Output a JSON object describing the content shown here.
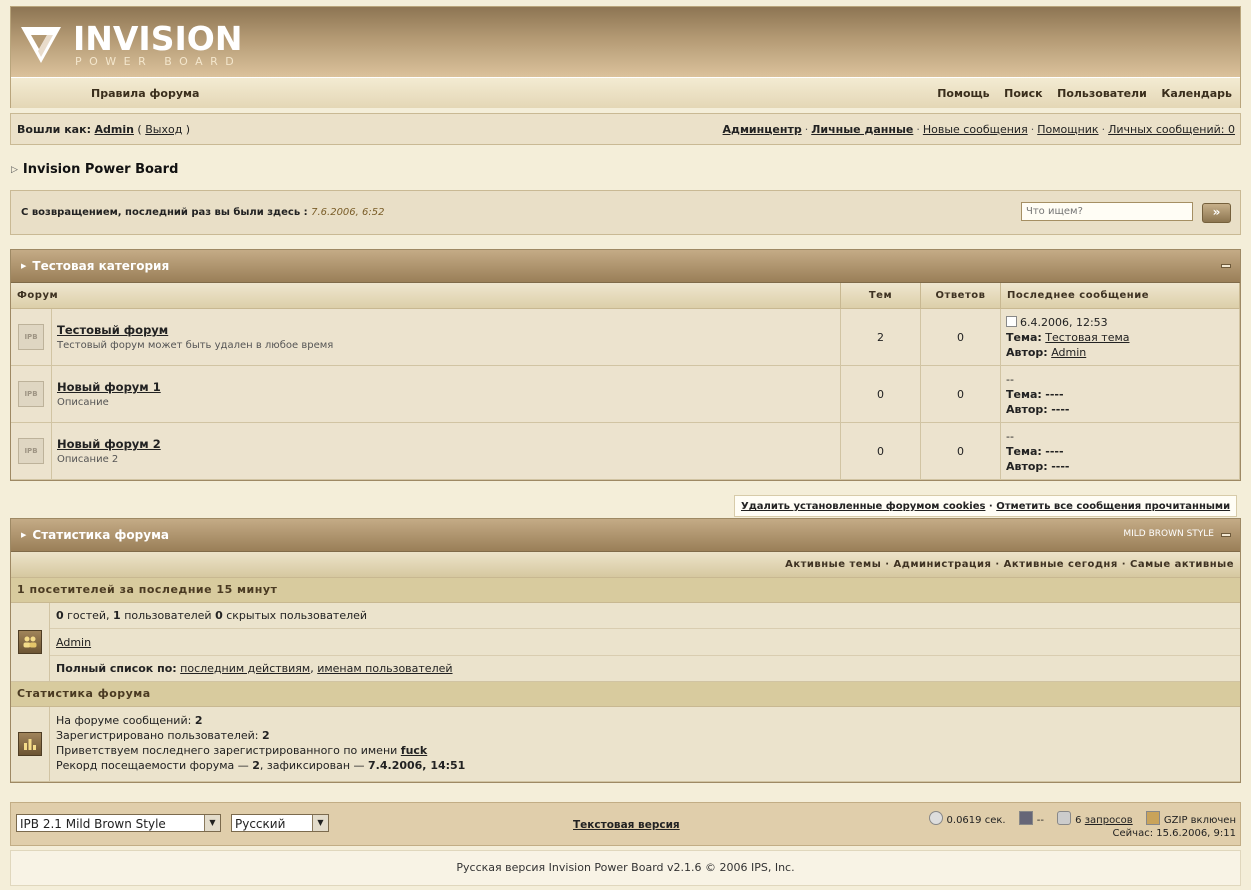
{
  "header": {
    "logo_main": "INVISION",
    "logo_sub": "POWER BOARD",
    "rules_link": "Правила форума",
    "nav": [
      "Помощь",
      "Поиск",
      "Пользователи",
      "Календарь"
    ]
  },
  "userbar": {
    "logged_in_as": "Вошли как:",
    "username": "Admin",
    "logout": "Выход",
    "links": [
      "Админцентр",
      "Личные данные",
      "Новые сообщения",
      "Помощник",
      "Личных сообщений: 0"
    ]
  },
  "breadcrumb": "Invision Power Board",
  "welcome": {
    "text": "С возвращением, последний раз вы были здесь :",
    "date": "7.6.2006, 6:52",
    "search_placeholder": "Что ищем?",
    "search_button": "»"
  },
  "category": {
    "title": "Тестовая категория",
    "columns": [
      "Форум",
      "Тем",
      "Ответов",
      "Последнее сообщение"
    ],
    "icon_text": "IPB",
    "forums": [
      {
        "name": "Тестовый форум",
        "desc": "Тестовый форум может быть удален в любое время",
        "topics": "2",
        "replies": "0",
        "last_date": "6.4.2006, 12:53",
        "topic_label": "Тема:",
        "topic": "Тестовая тема",
        "author_label": "Автор:",
        "author": "Admin"
      },
      {
        "name": "Новый форум 1",
        "desc": "Описание",
        "topics": "0",
        "replies": "0",
        "last_date": "--",
        "topic_label": "Тема:",
        "topic": "----",
        "author_label": "Автор:",
        "author": "----"
      },
      {
        "name": "Новый форум 2",
        "desc": "Описание 2",
        "topics": "0",
        "replies": "0",
        "last_date": "--",
        "topic_label": "Тема:",
        "topic": "----",
        "author_label": "Автор:",
        "author": "----"
      }
    ]
  },
  "board_links": {
    "delete_cookies": "Удалить установленные форумом cookies",
    "mark_read": "Отметить все сообщения прочитанными"
  },
  "stats": {
    "title": "Статистика форума",
    "style_label": "MILD BROWN STYLE",
    "links": [
      "Активные темы",
      "Администрация",
      "Активные сегодня",
      "Самые активные"
    ],
    "online_header": "1 посетителей за последние 15 минут",
    "guests_count": "0",
    "guests_label": "гостей,",
    "users_count": "1",
    "users_label": "пользователей",
    "hidden_count": "0",
    "hidden_label": "скрытых пользователей",
    "online_user": "Admin",
    "fulllist_label": "Полный список по:",
    "fulllist_by_action": "последним действиям",
    "fulllist_by_name": "именам пользователей",
    "board_stats_header": "Статистика форума",
    "posts_label": "На форуме сообщений:",
    "posts_value": "2",
    "members_label": "Зарегистрировано пользователей:",
    "members_value": "2",
    "newest_label": "Приветствуем последнего зарегистрированного по имени",
    "newest_value": "fuck",
    "record_label": "Рекорд посещаемости форума —",
    "record_value": "2",
    "record_mid": ", зафиксирован —",
    "record_date": "7.4.2006, 14:51"
  },
  "footer": {
    "skin_select": "IPB 2.1 Mild Brown Style",
    "lang_select": "Русский",
    "lofi": "Текстовая версия",
    "exec_time": "0.0619 сек.",
    "load": "--",
    "queries_count": "6",
    "queries_label": "запросов",
    "gzip": "GZIP включен",
    "time_label": "Сейчас:",
    "time_value": "15.6.2006, 9:11"
  },
  "copyright": "Русская версия Invision Power Board v2.1.6 © 2006  IPS, Inc."
}
